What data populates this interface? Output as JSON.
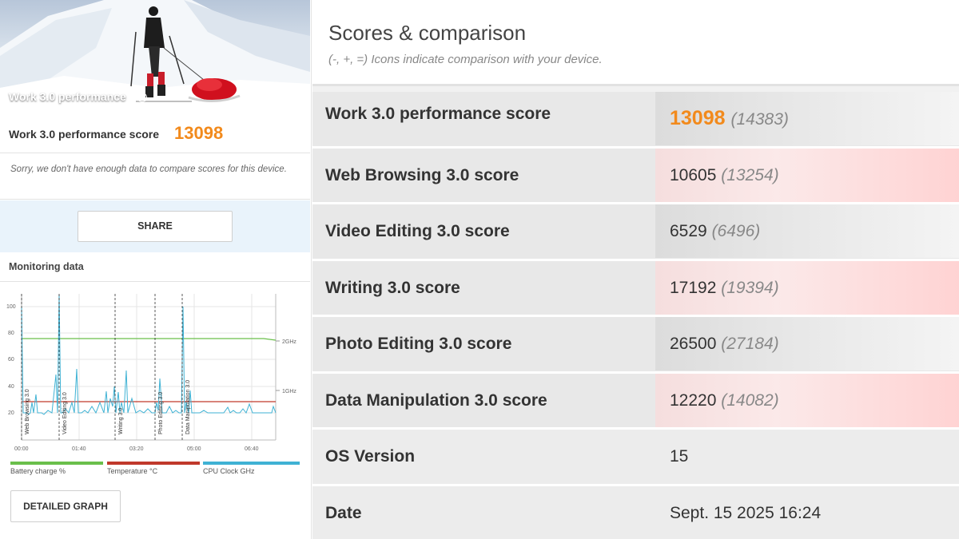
{
  "left": {
    "hero_title": "Work 3.0 performance",
    "score_label": "Work 3.0 performance score",
    "score_value": "13098",
    "sorry_text": "Sorry, we don't have enough data to compare scores for this device.",
    "share_label": "SHARE",
    "monitoring_title": "Monitoring data",
    "detailed_graph_label": "DETAILED GRAPH",
    "graph": {
      "y_ticks": [
        "100",
        "80",
        "60",
        "40",
        "20"
      ],
      "x_ticks": [
        "00:00",
        "01:40",
        "03:20",
        "05:00",
        "06:40"
      ],
      "right_ticks": [
        "2GHz",
        "1GHz"
      ],
      "markers": [
        "Web Browsing 3.0",
        "Video Editing 3.0",
        "Writing 3.0",
        "Photo Editing 3.0",
        "Data Manipulation 3.0"
      ]
    },
    "legend": [
      {
        "label": "Battery charge %",
        "color": "#6abf4b"
      },
      {
        "label": "Temperature °C",
        "color": "#c0392b"
      },
      {
        "label": "CPU Clock GHz",
        "color": "#3fb2d4"
      }
    ]
  },
  "right": {
    "title": "Scores & comparison",
    "subtitle": "(-, +, =) Icons indicate comparison with your device.",
    "rows": [
      {
        "name": "Work 3.0 performance score",
        "value": "13098",
        "compare": "(14383)"
      },
      {
        "name": "Web Browsing 3.0 score",
        "value": "10605",
        "compare": "(13254)"
      },
      {
        "name": "Video Editing 3.0 score",
        "value": "6529",
        "compare": "(6496)"
      },
      {
        "name": "Writing 3.0 score",
        "value": "17192",
        "compare": "(19394)"
      },
      {
        "name": "Photo Editing 3.0 score",
        "value": "26500",
        "compare": "(27184)"
      },
      {
        "name": "Data Manipulation 3.0 score",
        "value": "12220",
        "compare": "(14082)"
      },
      {
        "name": "OS Version",
        "value": "15",
        "compare": ""
      },
      {
        "name": "Date",
        "value": "Sept. 15 2025 16:24",
        "compare": ""
      }
    ]
  }
}
